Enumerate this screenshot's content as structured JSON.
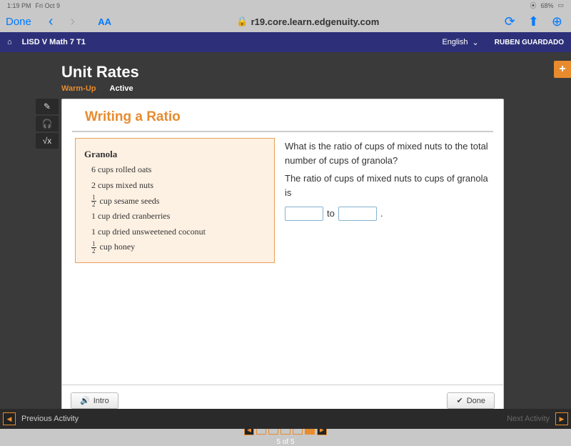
{
  "status": {
    "time": "1:19 PM",
    "date": "Fri Oct 9",
    "battery": "68%"
  },
  "safari": {
    "done": "Done",
    "aa": "AA",
    "url": "r19.core.learn.edgenuity.com"
  },
  "header": {
    "course": "LISD V Math 7 T1",
    "language": "English",
    "user": "RUBEN GUARDADO"
  },
  "unit": {
    "title": "Unit Rates",
    "warmup": "Warm-Up",
    "active": "Active"
  },
  "lesson": {
    "topic": "Writing a Ratio",
    "recipe": {
      "title": "Granola",
      "items": [
        "6 cups rolled oats",
        "2 cups mixed nuts",
        "1/2 cup sesame seeds",
        "1 cup dried cranberries",
        "1 cup dried unsweetened coconut",
        "1/2 cup honey"
      ]
    },
    "question1": "What is the ratio of cups of mixed nuts to the total number of cups of granola?",
    "question2": "The ratio of cups of mixed nuts to cups of granola is",
    "to": "to",
    "period": "."
  },
  "footer": {
    "intro": "Intro",
    "done": "Done"
  },
  "pager": {
    "label": "5 of 5"
  },
  "bottom": {
    "prev": "Previous Activity",
    "next": "Next Activity"
  }
}
